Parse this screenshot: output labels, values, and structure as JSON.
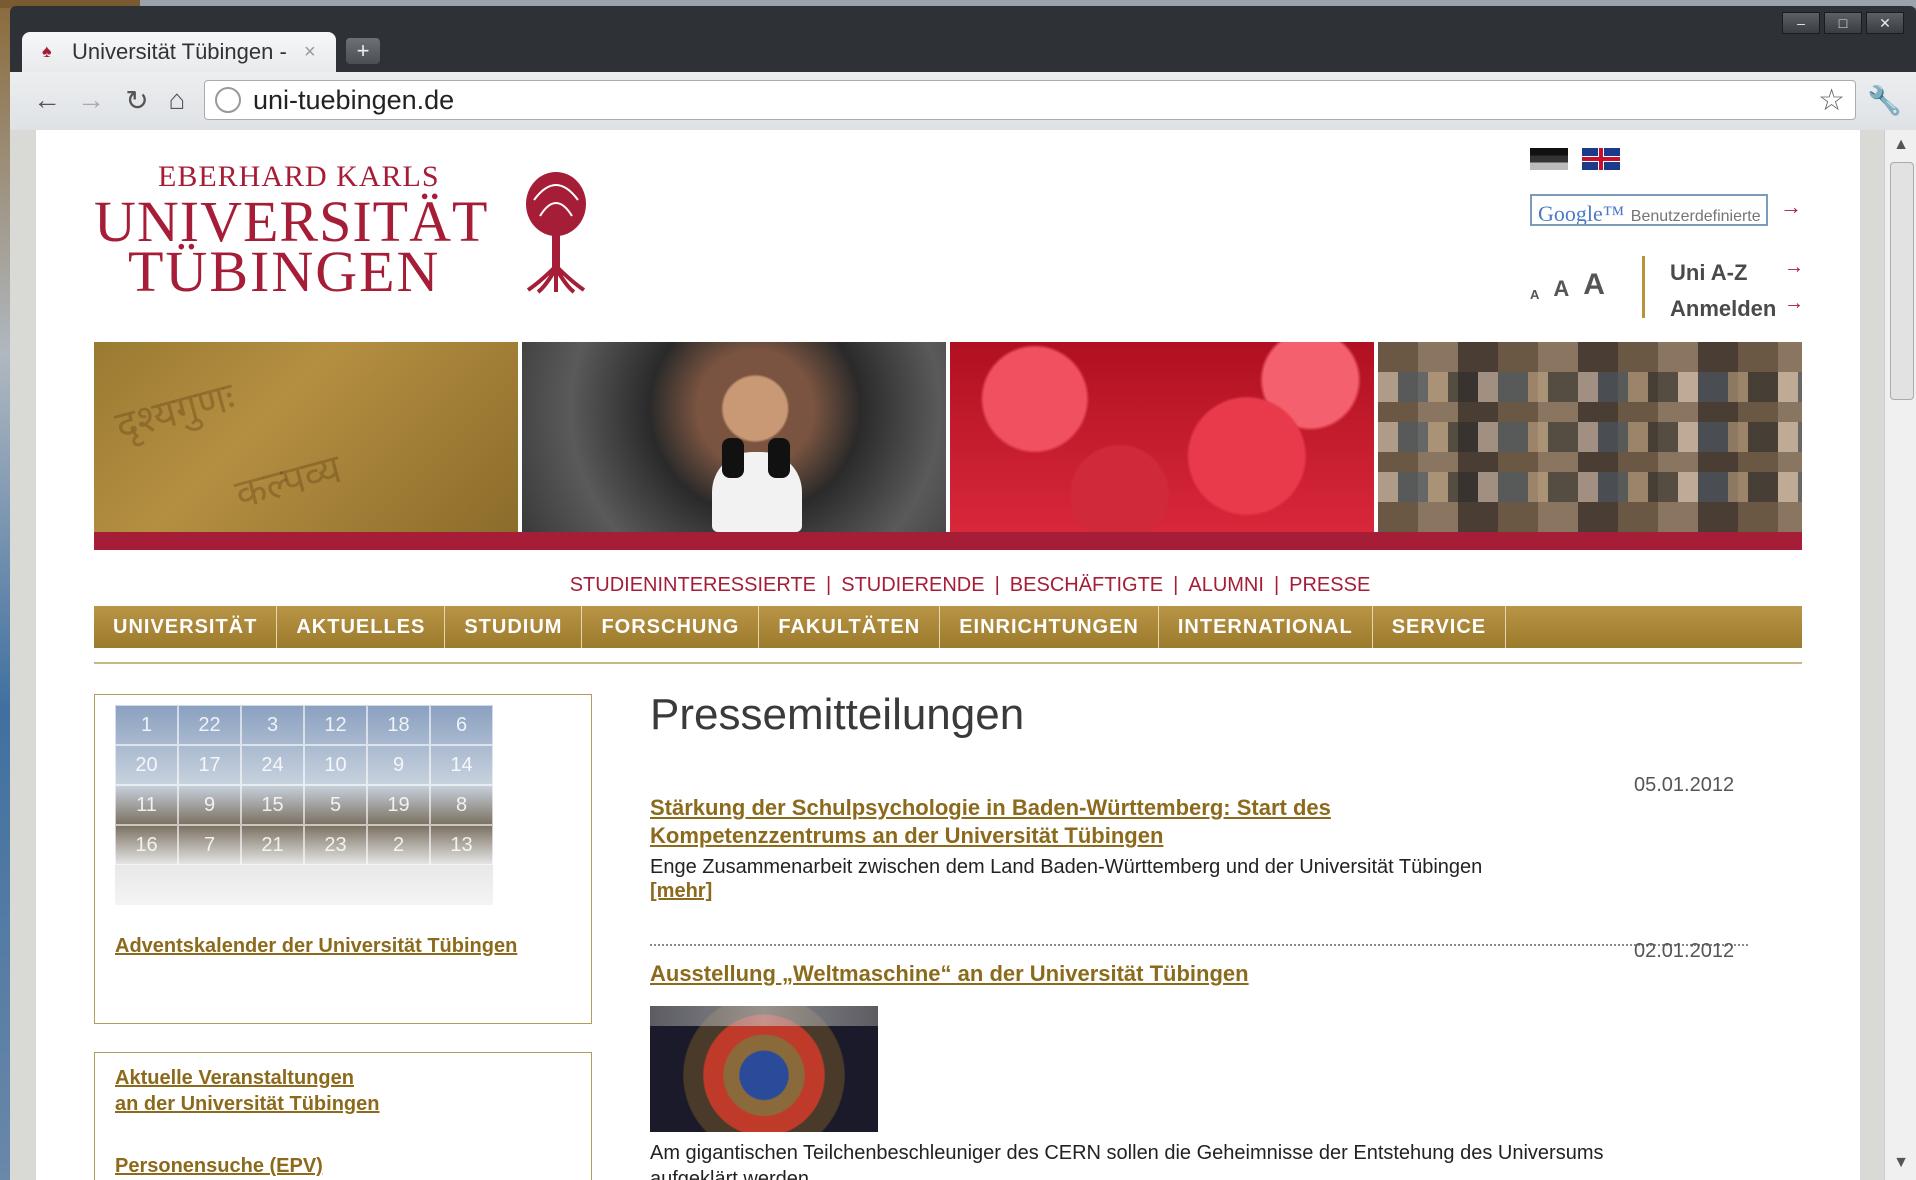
{
  "browser": {
    "tab_title": "Universität Tübingen - ",
    "tab_close": "×",
    "new_tab": "+",
    "url": "uni-tuebingen.de",
    "window_controls": [
      "–",
      "□",
      "✕"
    ]
  },
  "header": {
    "logo_line1": "EBERHARD KARLS",
    "logo_line2": "UNIVERSITÄT",
    "logo_line3": "TÜBINGEN",
    "search_brand": "Google™",
    "search_placeholder": "Benutzerdefinierte Suche",
    "search_go": "→",
    "font_small": "A",
    "font_medium": "A",
    "font_large": "A",
    "uni_az": "Uni A-Z",
    "anmelden": "Anmelden",
    "arrow": "→"
  },
  "target_nav": [
    "STUDIENINTERESSIERTE",
    "STUDIERENDE",
    "BESCHÄFTIGTE",
    "ALUMNI",
    "PRESSE"
  ],
  "target_sep": "|",
  "main_nav": [
    "UNIVERSITÄT",
    "AKTUELLES",
    "STUDIUM",
    "FORSCHUNG",
    "FAKULTÄTEN",
    "EINRICHTUNGEN",
    "INTERNATIONAL",
    "SERVICE"
  ],
  "sidebar": {
    "advent_numbers": [
      "1",
      "22",
      "3",
      "12",
      "18",
      "6",
      "20",
      "17",
      "24",
      "10",
      "9",
      "14",
      "11",
      "9",
      "15",
      "5",
      "19",
      "8",
      "16",
      "7",
      "21",
      "23",
      "2",
      "13"
    ],
    "advent_link": "Adventskalender der Universität Tübingen",
    "events_link_1": "Aktuelle Veranstaltungen",
    "events_link_2": "an der Universität Tübingen",
    "person_search": "Personensuche (EPV)"
  },
  "press": {
    "title": "Pressemitteilungen",
    "items": [
      {
        "date": "05.01.2012",
        "title_1": "Stärkung der Schulpsychologie in Baden-Württemberg: Start des",
        "title_2": "Kompetenzzentrums an der Universität Tübingen",
        "text": "Enge Zusammenarbeit zwischen dem Land Baden-Württemberg und der Universität Tübingen",
        "more": "[mehr]"
      },
      {
        "date": "02.01.2012",
        "title_1": "Ausstellung „Weltmaschine“ an der Universität Tübingen ",
        "text_1": "Am gigantischen Teilchenbeschleuniger des CERN sollen die Geheimnisse der Entstehung des Universums",
        "text_2": "aufgeklärt werden"
      }
    ]
  },
  "colors": {
    "brand_red": "#a51d36",
    "nav_gold": "#a9862f",
    "link_brown": "#8c6a1c"
  }
}
